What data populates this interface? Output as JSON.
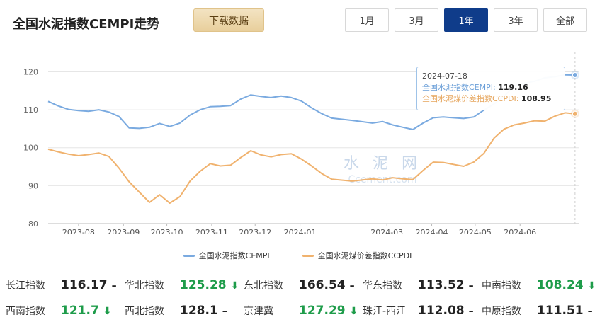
{
  "title": "全国水泥指数CEMPI走势",
  "download_label": "下载数据",
  "range_tabs": [
    {
      "label": "1月",
      "active": false
    },
    {
      "label": "3月",
      "active": false
    },
    {
      "label": "1年",
      "active": true
    },
    {
      "label": "3年",
      "active": false
    },
    {
      "label": "全部",
      "active": false
    }
  ],
  "watermark": {
    "cn": "水 泥 网",
    "en": "Ccement.com"
  },
  "tooltip": {
    "date": "2024-07-18",
    "row1_label": "全国水泥指数CEMPI:",
    "row1_value": "119.16",
    "row2_label": "全国水泥煤价差指数CCPDI:",
    "row2_value": "108.95"
  },
  "legend": [
    {
      "name": "全国水泥指数CEMPI",
      "color": "#7aaae0"
    },
    {
      "name": "全国水泥煤价差指数CCPDI",
      "color": "#f0b26e"
    }
  ],
  "chart_data": {
    "type": "line",
    "x_ticks": [
      "2023-08",
      "2023-09",
      "2023-10",
      "2023-11",
      "2023-12",
      "2024-01",
      "2024-03",
      "2024-04",
      "2024-05",
      "2024-06"
    ],
    "ylim": [
      80,
      124
    ],
    "y_ticks": [
      80,
      90,
      100,
      110,
      120
    ],
    "colors": {
      "cempi": "#7aaae0",
      "ccpdi": "#f0b26e"
    },
    "dates": [
      "2023-07-20",
      "2023-07-27",
      "2023-08-03",
      "2023-08-10",
      "2023-08-17",
      "2023-08-24",
      "2023-08-31",
      "2023-09-07",
      "2023-09-14",
      "2023-09-21",
      "2023-09-28",
      "2023-10-05",
      "2023-10-12",
      "2023-10-19",
      "2023-10-26",
      "2023-11-02",
      "2023-11-09",
      "2023-11-16",
      "2023-11-23",
      "2023-11-30",
      "2023-12-07",
      "2023-12-14",
      "2023-12-21",
      "2023-12-28",
      "2024-01-04",
      "2024-01-11",
      "2024-01-18",
      "2024-01-25",
      "2024-02-01",
      "2024-02-15",
      "2024-02-29",
      "2024-03-07",
      "2024-03-14",
      "2024-03-21",
      "2024-03-28",
      "2024-04-04",
      "2024-04-11",
      "2024-04-18",
      "2024-04-25",
      "2024-05-02",
      "2024-05-09",
      "2024-05-16",
      "2024-05-23",
      "2024-05-30",
      "2024-06-06",
      "2024-06-13",
      "2024-06-20",
      "2024-06-27",
      "2024-07-04",
      "2024-07-11",
      "2024-07-18"
    ],
    "series": [
      {
        "name": "全国水泥指数CEMPI",
        "key": "cempi",
        "values": [
          112.2,
          111.0,
          110.1,
          109.8,
          109.6,
          110.0,
          109.4,
          108.2,
          105.2,
          105.1,
          105.4,
          106.4,
          105.6,
          106.5,
          108.6,
          110.0,
          110.8,
          110.9,
          111.1,
          112.8,
          113.9,
          113.5,
          113.2,
          113.6,
          113.2,
          112.3,
          110.5,
          109.0,
          107.8,
          107.2,
          106.5,
          106.9,
          106.0,
          105.4,
          104.8,
          106.5,
          107.9,
          108.1,
          107.9,
          107.7,
          108.1,
          109.9,
          111.5,
          113.5,
          116.3,
          117.0,
          117.5,
          118.4,
          118.7,
          119.2,
          119.16
        ]
      },
      {
        "name": "全国水泥煤价差指数CCPDI",
        "key": "ccpdi",
        "values": [
          99.6,
          98.9,
          98.3,
          97.9,
          98.2,
          98.6,
          97.7,
          94.6,
          91.0,
          88.3,
          85.6,
          87.6,
          85.4,
          87.1,
          91.2,
          93.8,
          95.8,
          95.2,
          95.4,
          97.4,
          99.2,
          98.1,
          97.6,
          98.2,
          98.4,
          97.0,
          95.2,
          93.2,
          91.7,
          91.2,
          91.8,
          91.5,
          92.1,
          91.8,
          91.6,
          94.0,
          96.2,
          96.1,
          95.6,
          95.1,
          96.2,
          98.5,
          102.5,
          104.9,
          106.0,
          106.5,
          107.1,
          107.0,
          108.3,
          109.2,
          108.95
        ]
      }
    ]
  },
  "indices": [
    [
      {
        "name": "长江指数",
        "value": "116.17",
        "trend": "–",
        "dir": "flat"
      },
      {
        "name": "华北指数",
        "value": "125.28",
        "trend": "⬇",
        "dir": "down"
      },
      {
        "name": "东北指数",
        "value": "166.54",
        "trend": "–",
        "dir": "flat"
      },
      {
        "name": "华东指数",
        "value": "113.52",
        "trend": "–",
        "dir": "flat"
      },
      {
        "name": "中南指数",
        "value": "108.24",
        "trend": "⬇",
        "dir": "down"
      }
    ],
    [
      {
        "name": "西南指数",
        "value": "121.7",
        "trend": "⬇",
        "dir": "down"
      },
      {
        "name": "西北指数",
        "value": "128.1",
        "trend": "–",
        "dir": "flat"
      },
      {
        "name": "京津冀",
        "value": "127.29",
        "trend": "⬇",
        "dir": "down"
      },
      {
        "name": "珠江-西江",
        "value": "112.08",
        "trend": "–",
        "dir": "flat"
      },
      {
        "name": "中原指数",
        "value": "111.51",
        "trend": "–",
        "dir": "flat"
      }
    ]
  ]
}
